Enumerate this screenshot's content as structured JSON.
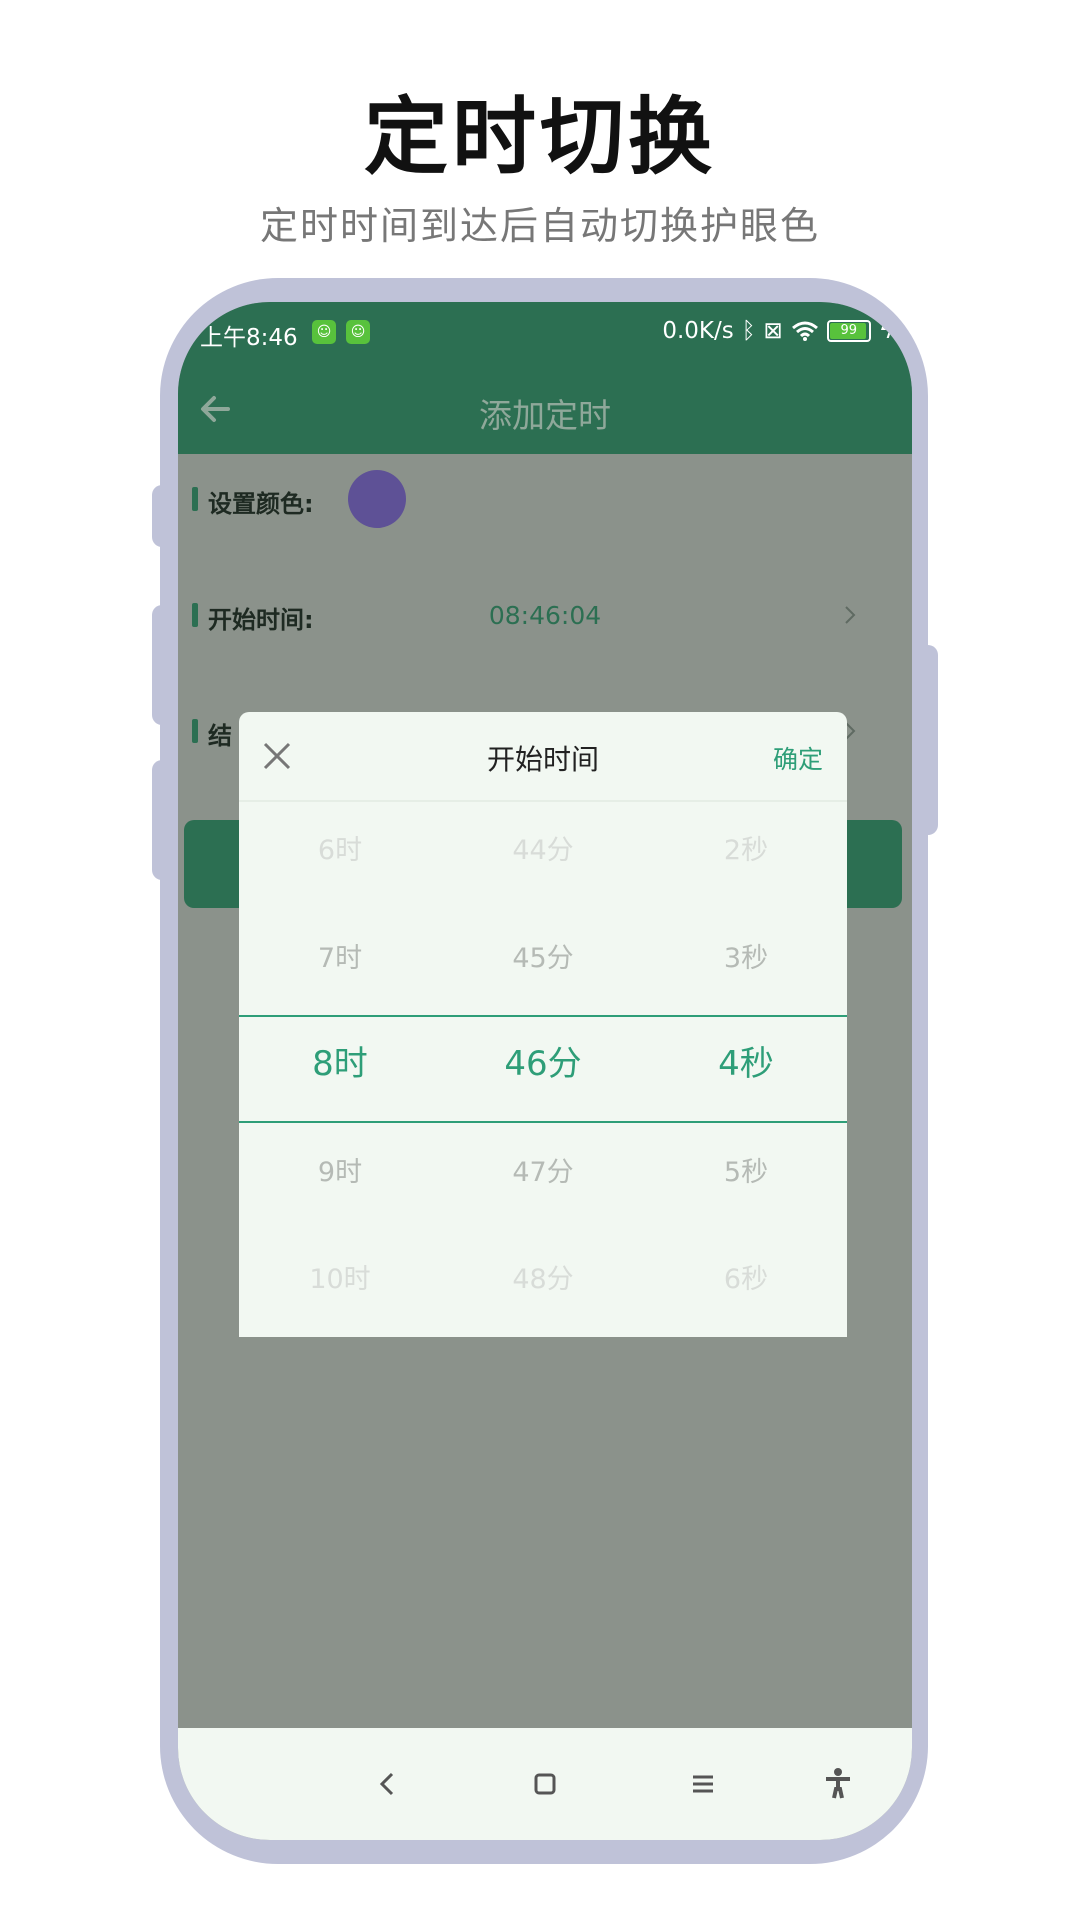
{
  "promo": {
    "title": "定时切换",
    "subtitle": "定时时间到达后自动切换护眼色"
  },
  "status_bar": {
    "time": "上午8:46",
    "net_speed": "0.0K/s",
    "battery": "99"
  },
  "app_bar": {
    "title": "添加定时"
  },
  "form": {
    "color_label": "设置颜色:",
    "color_value": "#5e5196",
    "start_label": "开始时间:",
    "start_value": "08:46:04",
    "end_label": "结"
  },
  "picker": {
    "title": "开始时间",
    "confirm": "确定",
    "hours": [
      "6时",
      "7时",
      "8时",
      "9时",
      "10时"
    ],
    "minutes": [
      "44分",
      "45分",
      "46分",
      "47分",
      "48分"
    ],
    "seconds": [
      "2秒",
      "3秒",
      "4秒",
      "5秒",
      "6秒"
    ]
  },
  "colors": {
    "primary": "#2c6f52",
    "accent": "#2e9e78",
    "frame": "#bfc2d8",
    "overlay": "#8b928b"
  },
  "icons": {
    "back": "arrow-left-icon",
    "close": "close-icon",
    "chevron": "chevron-right-icon",
    "nav_back": "nav-back-icon",
    "nav_home": "nav-home-icon",
    "nav_menu": "nav-menu-icon",
    "accessibility": "accessibility-icon"
  }
}
